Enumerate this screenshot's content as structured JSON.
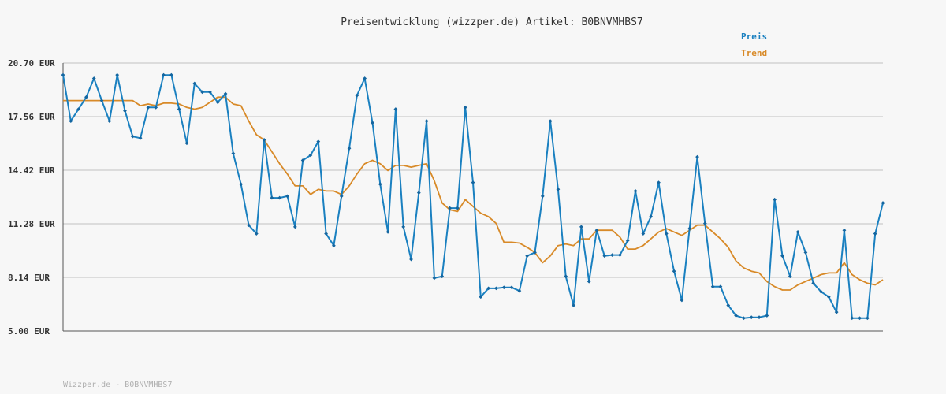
{
  "chart_data": {
    "type": "line",
    "title": "Preisentwicklung (wizzper.de) Artikel: B0BNVMHBS7",
    "ylim": [
      5.0,
      20.7
    ],
    "y_ticks": [
      "20.70 EUR",
      "17.56 EUR",
      "14.42 EUR",
      "11.28 EUR",
      "8.14 EUR",
      "5.00 EUR"
    ],
    "y_tick_values": [
      20.7,
      17.56,
      14.42,
      11.28,
      8.14,
      5.0
    ],
    "grid": true,
    "legend_position": "top-right",
    "series": [
      {
        "name": "Preis",
        "color": "#1a80c0",
        "values": [
          20.0,
          17.3,
          18.0,
          18.7,
          19.8,
          18.5,
          17.3,
          20.0,
          17.9,
          16.4,
          16.3,
          18.1,
          18.1,
          20.0,
          20.0,
          18.0,
          16.0,
          19.5,
          19.0,
          19.0,
          18.4,
          18.9,
          15.4,
          13.6,
          11.2,
          10.7,
          16.2,
          12.8,
          12.8,
          12.9,
          11.1,
          15.0,
          15.3,
          16.1,
          10.7,
          10.0,
          12.9,
          15.7,
          18.8,
          19.8,
          17.2,
          13.6,
          10.8,
          18.0,
          11.1,
          9.2,
          13.1,
          17.3,
          8.1,
          8.2,
          12.2,
          12.2,
          18.1,
          13.7,
          7.0,
          7.5,
          7.5,
          7.55,
          7.55,
          7.35,
          9.4,
          9.6,
          12.9,
          17.3,
          13.3,
          8.2,
          6.5,
          11.1,
          7.9,
          10.9,
          9.4,
          9.45,
          9.45,
          10.3,
          13.2,
          10.7,
          11.7,
          13.7,
          10.7,
          8.5,
          6.8,
          11.0,
          15.2,
          11.3,
          7.6,
          7.6,
          6.5,
          5.9,
          5.75,
          5.8,
          5.8,
          5.9,
          12.7,
          9.4,
          8.2,
          10.8,
          9.6,
          7.8,
          7.3,
          7.0,
          6.1,
          10.9,
          5.75,
          5.75,
          5.75,
          10.7,
          12.5
        ]
      },
      {
        "name": "Trend",
        "color": "#d88a28",
        "values": [
          18.5,
          18.5,
          18.5,
          18.5,
          18.5,
          18.5,
          18.5,
          18.5,
          18.5,
          18.5,
          18.2,
          18.3,
          18.2,
          18.35,
          18.35,
          18.3,
          18.1,
          18.0,
          18.1,
          18.4,
          18.7,
          18.7,
          18.3,
          18.2,
          17.3,
          16.5,
          16.2,
          15.5,
          14.8,
          14.2,
          13.5,
          13.5,
          13.0,
          13.3,
          13.2,
          13.2,
          13.0,
          13.5,
          14.2,
          14.8,
          15.0,
          14.8,
          14.4,
          14.7,
          14.7,
          14.6,
          14.7,
          14.8,
          13.8,
          12.5,
          12.1,
          12.0,
          12.7,
          12.3,
          11.9,
          11.7,
          11.3,
          10.2,
          10.2,
          10.15,
          9.9,
          9.6,
          9.0,
          9.4,
          10.0,
          10.1,
          10.0,
          10.4,
          10.4,
          10.9,
          10.9,
          10.9,
          10.5,
          9.8,
          9.8,
          10.0,
          10.4,
          10.8,
          11.0,
          10.8,
          10.6,
          10.9,
          11.2,
          11.2,
          10.8,
          10.4,
          9.9,
          9.1,
          8.7,
          8.5,
          8.4,
          7.9,
          7.6,
          7.4,
          7.4,
          7.7,
          7.9,
          8.1,
          8.3,
          8.4,
          8.4,
          9.0,
          8.3,
          8.0,
          7.8,
          7.7,
          8.0
        ]
      }
    ]
  },
  "footer": "Wizzper.de - B0BNVMHBS7"
}
